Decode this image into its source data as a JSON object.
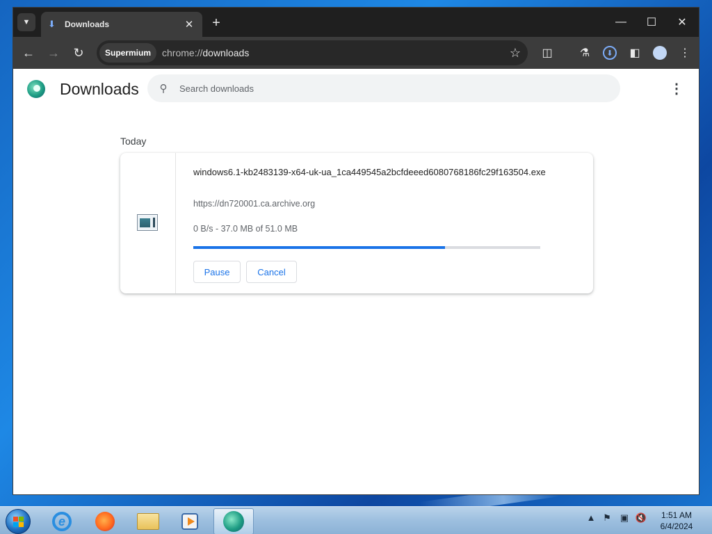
{
  "browser": {
    "tab": {
      "title": "Downloads",
      "icon": "download-icon"
    },
    "site_chip": "Supermium",
    "url_scheme": "chrome://",
    "url_host": "downloads"
  },
  "page": {
    "title": "Downloads",
    "search_placeholder": "Search downloads",
    "date_header": "Today",
    "download": {
      "file_name": "windows6.1-kb2483139-x64-uk-ua_1ca449545a2bcfdeeed6080768186fc29f163504.exe",
      "source_url": "https://dn720001.ca.archive.org",
      "status": "0 B/s - 37.0 MB of 51.0 MB",
      "progress_fraction": 0.725,
      "pause_label": "Pause",
      "cancel_label": "Cancel"
    }
  },
  "taskbar": {
    "clock_time": "1:51 AM",
    "clock_date": "6/4/2024"
  }
}
